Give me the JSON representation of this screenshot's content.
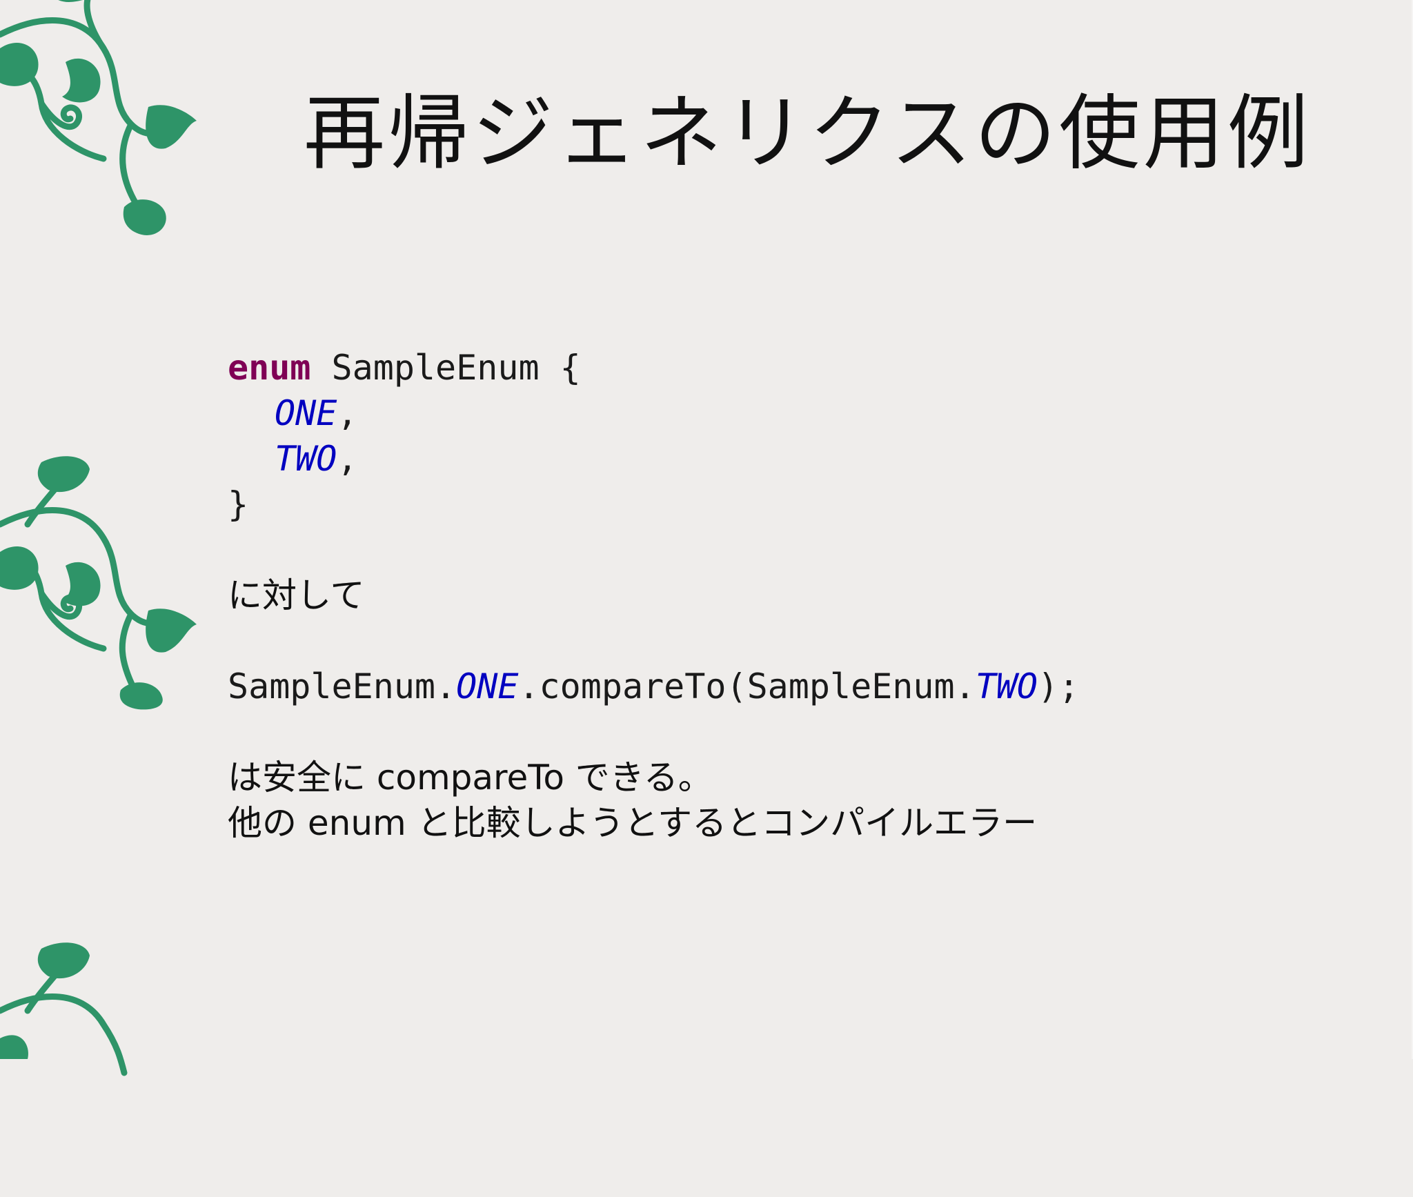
{
  "slide": {
    "title": "再帰ジェネリクスの使用例"
  },
  "code1": {
    "keyword": "enum",
    "type_name": " SampleEnum {",
    "const_one": "ONE",
    "const_two": "TWO",
    "comma": ",",
    "close": "}"
  },
  "text1": "に対して",
  "code2": {
    "part1": "SampleEnum.",
    "const_one": "ONE",
    "part2": ".compareTo(SampleEnum.",
    "const_two": "TWO",
    "part3": ");"
  },
  "text2": {
    "line1": "は安全に compareTo できる。",
    "line2": "他の enum と比較しようとするとコンパイルエラー"
  },
  "colors": {
    "background": "#efedeb",
    "vine": "#2e9468",
    "keyword": "#7f0055",
    "constant": "#0000c0",
    "text": "#111111"
  },
  "decorations": [
    "vine-ornament",
    "vine-ornament",
    "vine-ornament"
  ]
}
